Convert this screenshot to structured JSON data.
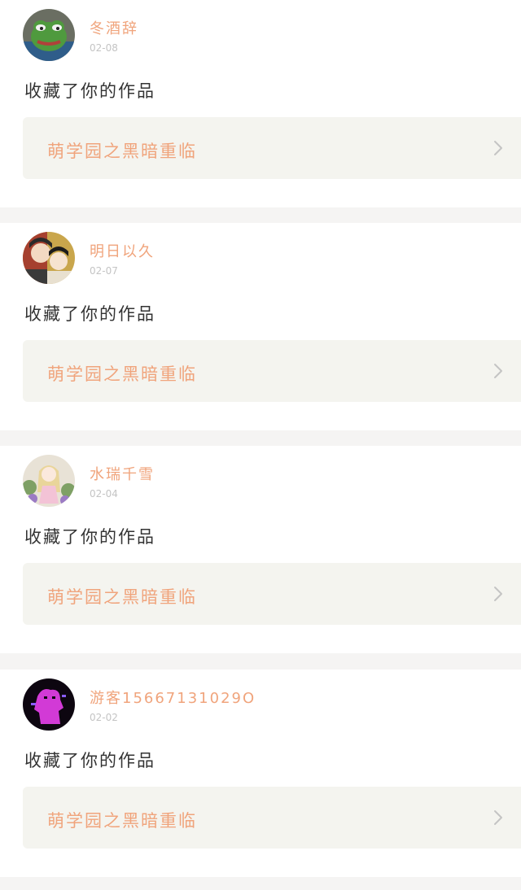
{
  "feed": {
    "items": [
      {
        "username": "冬酒辞",
        "date": "02-08",
        "action": "收藏了你的作品",
        "work_title": "萌学园之黑暗重临",
        "avatar_icon": "frog-avatar-icon",
        "avatar_colors": [
          "#6a6e62",
          "#4f9a3e"
        ]
      },
      {
        "username": "明日以久",
        "date": "02-07",
        "action": "收藏了你的作品",
        "work_title": "萌学园之黑暗重临",
        "avatar_icon": "anime-avatar-icon",
        "avatar_colors": [
          "#c9a64c",
          "#a6402f"
        ]
      },
      {
        "username": "水瑞千雪",
        "date": "02-04",
        "action": "收藏了你的作品",
        "work_title": "萌学园之黑暗重临",
        "avatar_icon": "anime-girl-avatar-icon",
        "avatar_colors": [
          "#e8e2d6",
          "#7ea065"
        ]
      },
      {
        "username": "游客15667131029O",
        "date": "02-02",
        "action": "收藏了你的作品",
        "work_title": "萌学园之黑暗重临",
        "avatar_icon": "glitch-avatar-icon",
        "avatar_colors": [
          "#0d0610",
          "#d23ad6"
        ]
      }
    ]
  },
  "colors": {
    "accent": "#f0a47c",
    "card_background": "#ffffff",
    "page_background": "#f5f4f3",
    "link_background": "#f4f4ef",
    "action_text": "#333333",
    "date_text": "#c4c4c4"
  }
}
